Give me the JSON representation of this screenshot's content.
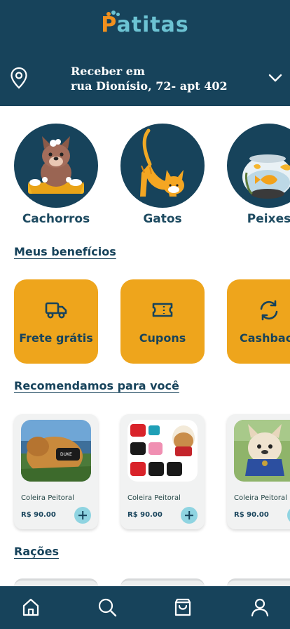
{
  "header": {
    "logo_first": "P",
    "logo_rest": "atitas",
    "address_line1": "Receber em",
    "address_line2": "rua Dionísio, 72- apt 402"
  },
  "categories": [
    {
      "label": "Cachorros"
    },
    {
      "label": "Gatos"
    },
    {
      "label": "Peixes"
    }
  ],
  "benefits_title": "Meus benefícios",
  "benefits": [
    {
      "label": "Frete grátis",
      "icon": "truck-icon"
    },
    {
      "label": "Cupons",
      "icon": "ticket-icon"
    },
    {
      "label": "Cashback",
      "icon": "refresh-icon"
    }
  ],
  "recommend_title": "Recomendamos para você",
  "products": [
    {
      "name": "Coleira Peitoral",
      "price": "R$ 90.00"
    },
    {
      "name": "Coleira Peitoral",
      "price": "R$ 90.00"
    },
    {
      "name": "Coleira Peitoral",
      "price": "R$ 90.00"
    }
  ],
  "racoes_title": "Rações",
  "nav": [
    "home-icon",
    "search-icon",
    "bag-icon",
    "profile-icon"
  ],
  "colors": {
    "primary": "#17435b",
    "accent": "#eea51c",
    "brand_cyan": "#6cc3d3",
    "brand_orange": "#f0901e"
  }
}
